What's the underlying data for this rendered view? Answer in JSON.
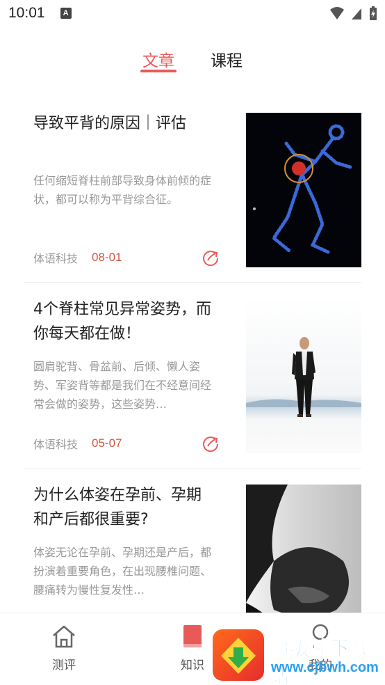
{
  "status_bar": {
    "time": "10:01",
    "notification_badge": "A"
  },
  "tabs": [
    {
      "label": "文章",
      "active": true
    },
    {
      "label": "课程",
      "active": false
    }
  ],
  "articles": [
    {
      "title": "导致平背的原因｜评估",
      "desc": "任何缩短脊柱前部导致身体前倾的症状，都可以称为平背综合征。",
      "author": "体语科技",
      "date": "08-01",
      "thumb": "glowing-skeleton-figure"
    },
    {
      "title": "4个脊柱常见异常姿势，而你每天都在做！",
      "desc": "圆肩驼背、骨盆前、后倾、懒人姿势、军姿背等都是我们在不经意间经常会做的姿势，这些姿势…",
      "author": "体语科技",
      "date": "05-07",
      "thumb": "standing-man-photo"
    },
    {
      "title": "为什么体姿在孕前、孕期和产后都很重要?",
      "desc": "体姿无论在孕前、孕期还是产后，都扮演着重要角色，在出现腰椎问题、腰痛转为慢性复发性…",
      "author": "",
      "date": "",
      "thumb": "pregnant-belly-photo"
    }
  ],
  "bottom_nav": [
    {
      "label": "测评",
      "icon": "home-icon"
    },
    {
      "label": "知识",
      "icon": "book-icon"
    },
    {
      "label": "我的",
      "icon": "person-icon"
    }
  ],
  "watermark": {
    "line1": "超级棒下载站",
    "line2": "www.cjbwh.com"
  },
  "colors": {
    "accent": "#e85a5a",
    "date": "#d0543f",
    "muted": "#999999"
  }
}
